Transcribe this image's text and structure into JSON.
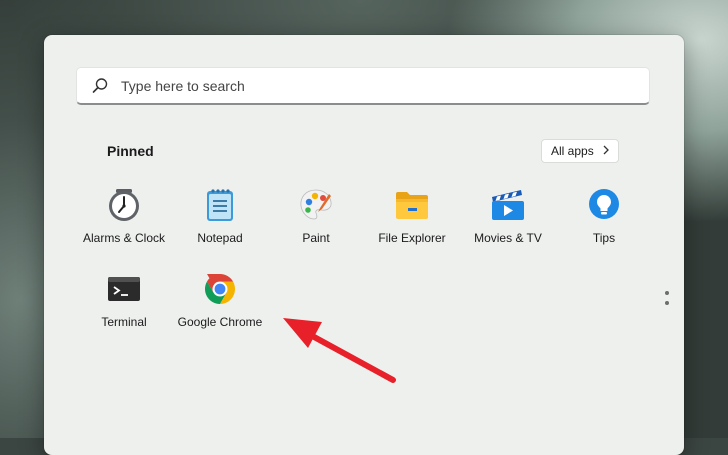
{
  "search": {
    "placeholder": "Type here to search"
  },
  "pinned": {
    "title": "Pinned",
    "all_apps_label": "All apps",
    "apps": [
      {
        "label": "Alarms & Clock",
        "icon": "alarm-clock-icon"
      },
      {
        "label": "Notepad",
        "icon": "notepad-icon"
      },
      {
        "label": "Paint",
        "icon": "paint-palette-icon"
      },
      {
        "label": "File Explorer",
        "icon": "folder-icon"
      },
      {
        "label": "Movies & TV",
        "icon": "movies-tv-icon"
      },
      {
        "label": "Tips",
        "icon": "lightbulb-icon"
      },
      {
        "label": "Terminal",
        "icon": "terminal-icon"
      },
      {
        "label": "Google Chrome",
        "icon": "chrome-icon"
      }
    ]
  },
  "colors": {
    "annotation_arrow": "#e8202a",
    "menu_background": "#eef0ee"
  }
}
